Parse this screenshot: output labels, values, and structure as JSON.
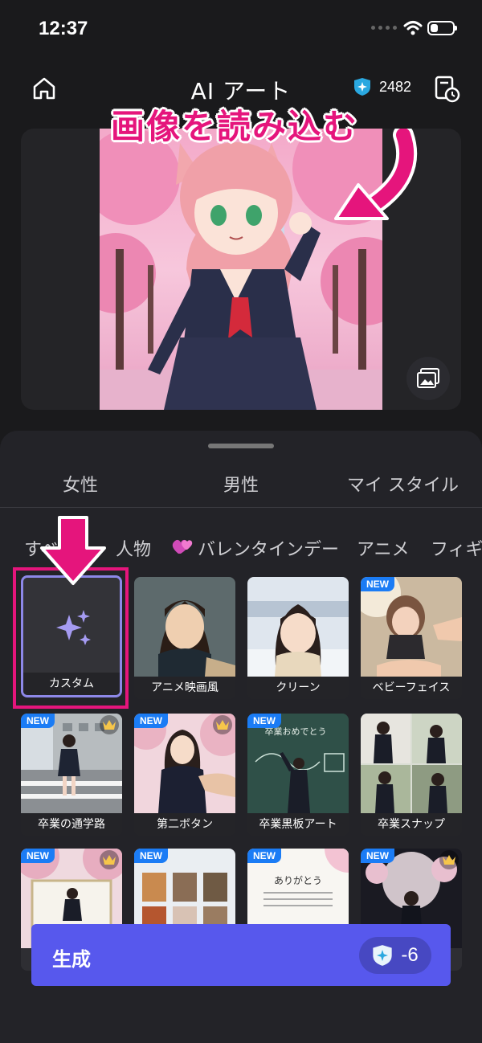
{
  "status_bar": {
    "time": "12:37"
  },
  "header": {
    "title": "AI アート",
    "credits": "2482"
  },
  "annotation": {
    "text": "画像を読み込む"
  },
  "tabs": [
    "女性",
    "男性",
    "マイ スタイル"
  ],
  "chips": [
    "すべて",
    "人物",
    "バレンタインデー",
    "アニメ",
    "フィギ"
  ],
  "cards": [
    {
      "label": "カスタム",
      "new": false,
      "premium": false
    },
    {
      "label": "アニメ映画風",
      "new": false,
      "premium": false
    },
    {
      "label": "クリーン",
      "new": false,
      "premium": false
    },
    {
      "label": "ベビーフェイス",
      "new": true,
      "premium": false
    },
    {
      "label": "卒業の通学路",
      "new": true,
      "premium": true
    },
    {
      "label": "第二ボタン",
      "new": true,
      "premium": true
    },
    {
      "label": "卒業黒板アート",
      "new": true,
      "premium": false
    },
    {
      "label": "卒業スナップ",
      "new": false,
      "premium": false
    },
    {
      "label": "",
      "new": true,
      "premium": true
    },
    {
      "label": "",
      "new": true,
      "premium": false
    },
    {
      "label": "",
      "new": true,
      "premium": false
    },
    {
      "label": "",
      "new": true,
      "premium": true
    }
  ],
  "badges": {
    "new": "NEW"
  },
  "card_texts": {
    "chalkboard": "卒業おめでとう",
    "thanks": "ありがとう"
  },
  "generate": {
    "label": "生成",
    "cost": "-6"
  },
  "colors": {
    "accent": "#5758ed",
    "annotation": "#e5157c",
    "badge": "#1b7cf5"
  }
}
